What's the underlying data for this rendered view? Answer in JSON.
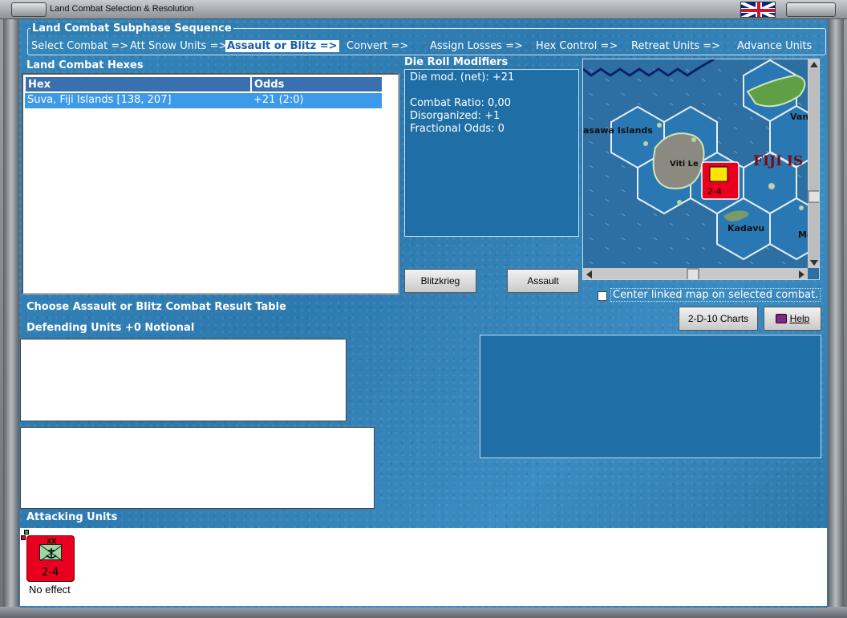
{
  "window": {
    "title": "Land Combat Selection & Resolution"
  },
  "sequence": {
    "title": "Land Combat Subphase Sequence",
    "items": [
      {
        "label": "Select Combat =>",
        "active": false
      },
      {
        "label": "Att Snow Units =>",
        "active": false
      },
      {
        "label": "Assault or Blitz =>",
        "active": true
      },
      {
        "label": "Convert =>",
        "active": false
      },
      {
        "label": "Assign Losses =>",
        "active": false
      },
      {
        "label": "Hex Control =>",
        "active": false
      },
      {
        "label": "Retreat Units =>",
        "active": false
      },
      {
        "label": "Advance Units",
        "active": false
      }
    ]
  },
  "hexes": {
    "title": "Land Combat Hexes",
    "columns": [
      "Hex",
      "Odds"
    ],
    "rows": [
      {
        "hex": "Suva, Fiji Islands [138, 207]",
        "odds": "+21 (2:0)"
      }
    ]
  },
  "modifiers": {
    "title": "Die Roll Modifiers",
    "lines": [
      "Die mod. (net): +21",
      "",
      "Combat Ratio: 0,00",
      "Disorganized: +1",
      "Fractional Odds: 0"
    ]
  },
  "map": {
    "labels": [
      "asawa Islands",
      "Viti Le",
      "FIJI IS",
      "Kadavu",
      "Van",
      "Mo"
    ],
    "counter_strength": "2-4"
  },
  "buttons": {
    "blitzkrieg": "Blitzkrieg",
    "assault": "Assault",
    "charts": "2-D-10 Charts",
    "help": "Help"
  },
  "center_map": {
    "label": "Center linked map on selected combat.",
    "checked": false
  },
  "crt_label": "Choose Assault or Blitz Combat Result Table",
  "defending_label": "Defending Units +0 Notional",
  "attacking_label": "Attacking Units",
  "attacker": {
    "strength": "2-4",
    "size": "XX",
    "result": "No effect"
  },
  "colors": {
    "accent": "#3d9ae8",
    "counter": "#e8001e",
    "water": "#2b79ae"
  }
}
